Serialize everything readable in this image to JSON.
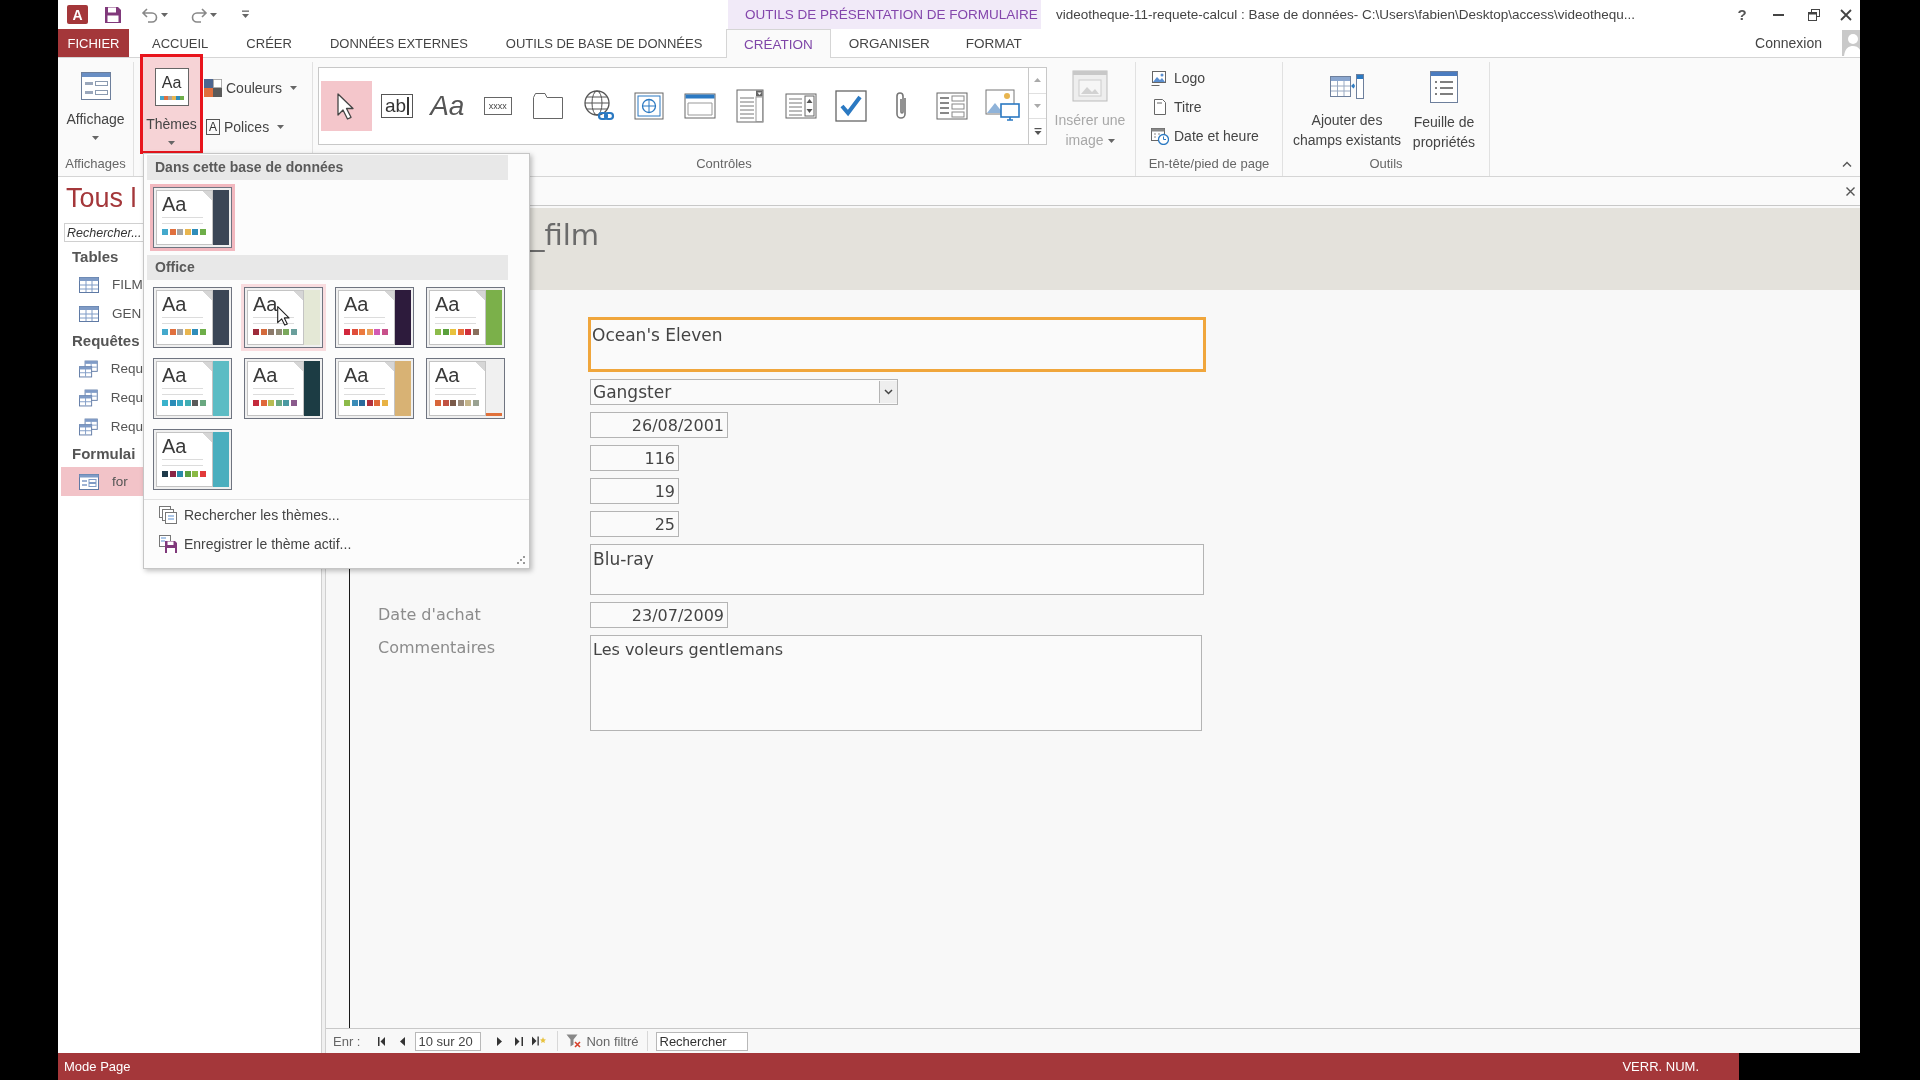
{
  "title_bar": {
    "app_icon": "A",
    "context_group": "OUTILS DE PRÉSENTATION DE FORMULAIRE",
    "title": "videotheque-11-requete-calcul : Base de données- C:\\Users\\fabien\\Desktop\\access\\videothequ...",
    "help": "?"
  },
  "ribbon_tabs": [
    {
      "label": "FICHIER",
      "kind": "file",
      "selected": false
    },
    {
      "label": "ACCUEIL",
      "kind": "standard",
      "selected": false
    },
    {
      "label": "CRÉER",
      "kind": "standard",
      "selected": false
    },
    {
      "label": "DONNÉES EXTERNES",
      "kind": "standard",
      "selected": false
    },
    {
      "label": "OUTILS DE BASE DE DONNÉES",
      "kind": "standard",
      "selected": false
    },
    {
      "label": "CRÉATION",
      "kind": "context",
      "selected": true
    },
    {
      "label": "ORGANISER",
      "kind": "context",
      "selected": false
    },
    {
      "label": "FORMAT",
      "kind": "context",
      "selected": false
    }
  ],
  "account": {
    "label": "Connexion"
  },
  "ribbon": {
    "views": {
      "label": "Affichages",
      "button": "Affichage"
    },
    "themes": {
      "button": "Thèmes",
      "glyph": "Aa",
      "pressed": true,
      "annotated": true,
      "colors": "Couleurs",
      "fonts": "Polices",
      "fonts_glyph": "A"
    },
    "controls": {
      "label": "Contrôles",
      "tools": [
        {
          "kind": "select",
          "selected": true
        },
        {
          "kind": "textbox",
          "glyph": "ab",
          "selected": false
        },
        {
          "kind": "label",
          "glyph": "Aa",
          "selected": false
        },
        {
          "kind": "button",
          "glyph": "xxxx",
          "selected": false
        },
        {
          "kind": "tab",
          "selected": false
        },
        {
          "kind": "hyperlink",
          "selected": false
        },
        {
          "kind": "web",
          "selected": false
        },
        {
          "kind": "navigation",
          "selected": false
        },
        {
          "kind": "combo",
          "selected": false
        },
        {
          "kind": "listbox",
          "selected": false
        },
        {
          "kind": "checkbox",
          "selected": false
        },
        {
          "kind": "attachment",
          "selected": false
        },
        {
          "kind": "option",
          "selected": false
        },
        {
          "kind": "chart",
          "selected": false
        }
      ],
      "insert_image": {
        "label": "Insérer une\nimage",
        "disabled": true
      }
    },
    "header_footer": {
      "label": "En-tête/pied de page",
      "items": [
        {
          "kind": "logo",
          "label": "Logo"
        },
        {
          "kind": "title",
          "label": "Titre"
        },
        {
          "kind": "datetime",
          "label": "Date et heure"
        }
      ]
    },
    "tools": {
      "label": "Outils",
      "items": [
        {
          "kind": "fields",
          "label": "Ajouter des\nchamps existants"
        },
        {
          "kind": "sheet",
          "label": "Feuille de\npropriétés"
        }
      ]
    }
  },
  "theme_menu": {
    "sections": [
      {
        "title": "Dans cette base de données",
        "themes": [
          {
            "sample": "Aa",
            "selected": true,
            "hovered": false,
            "accent": {
              "kind": "strip",
              "color": "#3b4656"
            },
            "swatches": [
              {
                "color": "#44a9cc"
              },
              {
                "color": "#e0703e"
              },
              {
                "color": "#a5a5a5"
              },
              {
                "color": "#e8b54f"
              },
              {
                "color": "#2f8dba"
              },
              {
                "color": "#6eae49"
              }
            ]
          }
        ]
      },
      {
        "title": "Office",
        "themes": [
          {
            "sample": "Aa",
            "selected": false,
            "hovered": false,
            "accent": {
              "kind": "strip",
              "color": "#3b4656"
            },
            "swatches": [
              {
                "color": "#44a9cc"
              },
              {
                "color": "#e0703e"
              },
              {
                "color": "#a5a5a5"
              },
              {
                "color": "#e8b54f"
              },
              {
                "color": "#2f8dba"
              },
              {
                "color": "#6eae49"
              }
            ]
          },
          {
            "sample": "Aa",
            "selected": false,
            "hovered": true,
            "accent": {
              "kind": "strip",
              "color": "#e4e8d6"
            },
            "swatches": [
              {
                "color": "#9e2b3a"
              },
              {
                "color": "#d36a3c"
              },
              {
                "color": "#8c7a6b"
              },
              {
                "color": "#8f8a76"
              },
              {
                "color": "#7aa85c"
              },
              {
                "color": "#6a9f9c"
              }
            ]
          },
          {
            "sample": "Aa",
            "selected": false,
            "hovered": false,
            "accent": {
              "kind": "strip",
              "color": "#2d1b3c"
            },
            "swatches": [
              {
                "color": "#d2283c"
              },
              {
                "color": "#e04e3a"
              },
              {
                "color": "#ec7a3e"
              },
              {
                "color": "#e8a05a"
              },
              {
                "color": "#d25ab4"
              },
              {
                "color": "#c8508a"
              }
            ]
          },
          {
            "sample": "Aa",
            "selected": false,
            "hovered": false,
            "accent": {
              "kind": "strip",
              "color": "#7bb04a"
            },
            "swatches": [
              {
                "color": "#8cbb4a"
              },
              {
                "color": "#5aa03c"
              },
              {
                "color": "#e8c23e"
              },
              {
                "color": "#e8703a"
              },
              {
                "color": "#d0303c"
              },
              {
                "color": "#8a705e"
              }
            ]
          },
          {
            "sample": "Aa",
            "selected": false,
            "hovered": false,
            "accent": {
              "kind": "strip",
              "color": "#5cbcc4"
            },
            "swatches": [
              {
                "color": "#3ab2cc"
              },
              {
                "color": "#2a8cb8"
              },
              {
                "color": "#38a8c4"
              },
              {
                "color": "#40aeb4"
              },
              {
                "color": "#5a5a5a"
              },
              {
                "color": "#6aa880"
              }
            ]
          },
          {
            "sample": "Aa",
            "selected": false,
            "hovered": false,
            "accent": {
              "kind": "strip",
              "color": "#1c3c44"
            },
            "swatches": [
              {
                "color": "#c42a3c"
              },
              {
                "color": "#e0683a"
              },
              {
                "color": "#b8bc52"
              },
              {
                "color": "#6aa882"
              },
              {
                "color": "#4a9aa2"
              },
              {
                "color": "#8a5a8c"
              }
            ]
          },
          {
            "sample": "Aa",
            "selected": false,
            "hovered": false,
            "accent": {
              "kind": "strip",
              "color": "#d8b274"
            },
            "swatches": [
              {
                "color": "#8cba4a"
              },
              {
                "color": "#3a8cb8"
              },
              {
                "color": "#2a6a9c"
              },
              {
                "color": "#b2303c"
              },
              {
                "color": "#e06a3a"
              },
              {
                "color": "#e8b244"
              }
            ]
          },
          {
            "sample": "Aa",
            "selected": false,
            "hovered": false,
            "accent": {
              "kind": "underline",
              "color": "#e0703a"
            },
            "swatches": [
              {
                "color": "#d8663a"
              },
              {
                "color": "#c25242"
              },
              {
                "color": "#7a5a4a"
              },
              {
                "color": "#9a8a7a"
              },
              {
                "color": "#c4b48a"
              },
              {
                "color": "#9aa292"
              }
            ]
          },
          {
            "sample": "Aa",
            "selected": false,
            "hovered": false,
            "accent": {
              "kind": "strip",
              "color": "#4aaebe"
            },
            "swatches": [
              {
                "color": "#1e3a4a"
              },
              {
                "color": "#8a2444"
              },
              {
                "color": "#2a8aa8"
              },
              {
                "color": "#5aa040"
              },
              {
                "color": "#8aba44"
              },
              {
                "color": "#e23a3a"
              }
            ]
          }
        ]
      }
    ],
    "commands": [
      {
        "kind": "browse",
        "label": "Rechercher les thèmes..."
      },
      {
        "kind": "save",
        "label": "Enregistrer le thème actif..."
      }
    ]
  },
  "navigation": {
    "title": "Tous l",
    "search": {
      "placeholder": "Rechercher..."
    },
    "groups": [
      {
        "title": "Tables",
        "items": [
          {
            "kind": "table",
            "label": "FILM",
            "selected": false
          },
          {
            "kind": "table",
            "label": "GEN",
            "selected": false
          }
        ]
      },
      {
        "title": "Requêtes",
        "items": [
          {
            "kind": "query",
            "label": "Requ",
            "selected": false
          },
          {
            "kind": "query",
            "label": "Requ",
            "selected": false
          },
          {
            "kind": "query",
            "label": "Requ",
            "selected": false
          }
        ]
      },
      {
        "title": "Formulai",
        "items": [
          {
            "kind": "form",
            "label": "for",
            "selected": true
          }
        ]
      }
    ]
  },
  "form": {
    "title": "_film",
    "fields": [
      {
        "kind": "text",
        "value": "Ocean's Eleven",
        "focused": true
      },
      {
        "kind": "combo",
        "value": "Gangster",
        "focused": false
      },
      {
        "kind": "date",
        "value": "26/08/2001",
        "focused": false
      },
      {
        "kind": "number",
        "value": "116",
        "focused": false
      },
      {
        "kind": "number",
        "value": "19",
        "focused": false
      },
      {
        "kind": "number",
        "value": "25",
        "focused": false
      },
      {
        "kind": "text",
        "value": "Blu-ray",
        "focused": false
      },
      {
        "kind": "date",
        "label": "Date d'achat",
        "value": "23/07/2009",
        "focused": false
      },
      {
        "kind": "memo",
        "label": "Commentaires",
        "value": "Les voleurs gentlemans",
        "focused": false
      }
    ]
  },
  "record_nav": {
    "label": "Enr :",
    "position": "10 sur 20",
    "filter": "Non filtré",
    "search": {
      "placeholder": "Rechercher"
    }
  },
  "status_bar": {
    "mode": "Mode Page",
    "indicator": "VERR. NUM."
  }
}
